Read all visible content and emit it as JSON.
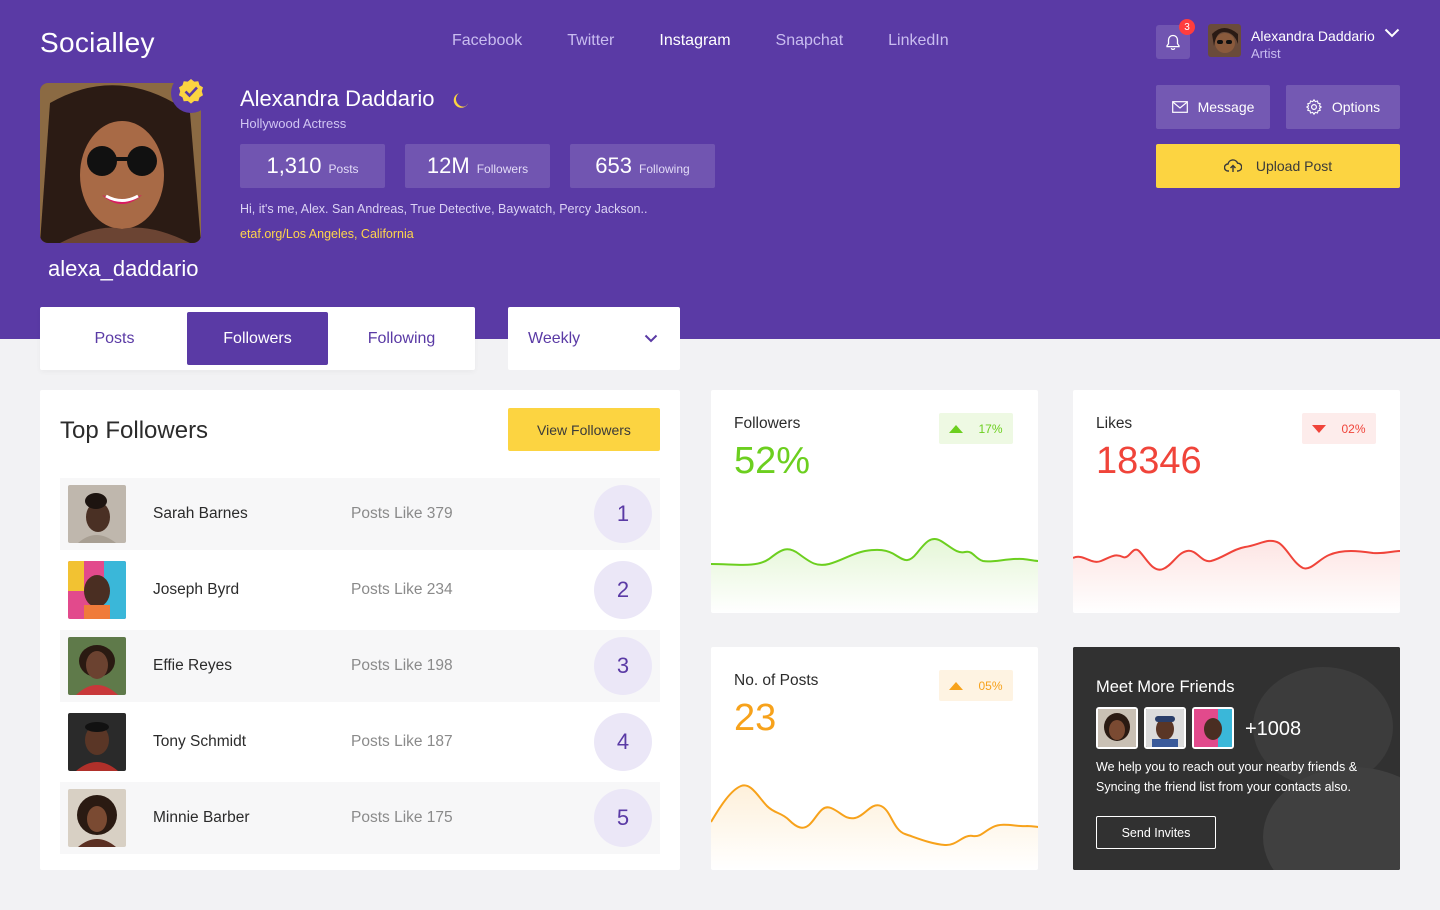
{
  "brand": "Socialley",
  "nav": {
    "items": [
      {
        "label": "Facebook",
        "active": false
      },
      {
        "label": "Twitter",
        "active": false
      },
      {
        "label": "Instagram",
        "active": true
      },
      {
        "label": "Snapchat",
        "active": false
      },
      {
        "label": "LinkedIn",
        "active": false
      }
    ]
  },
  "notifications": {
    "count": "3"
  },
  "current_user": {
    "name": "Alexandra Daddario",
    "role": "Artist"
  },
  "profile": {
    "name": "Alexandra Daddario",
    "title": "Hollywood Actress",
    "handle": "alexa_daddario",
    "stats": [
      {
        "value": "1,310",
        "label": "Posts"
      },
      {
        "value": "12M",
        "label": "Followers"
      },
      {
        "value": "653",
        "label": "Following"
      }
    ],
    "bio": "Hi, it's me, Alex. San Andreas, True Detective, Baywatch, Percy Jackson..",
    "link": "etaf.org/Los Angeles, California"
  },
  "actions": {
    "message": "Message",
    "options": "Options",
    "upload": "Upload Post"
  },
  "tabs": [
    {
      "label": "Posts",
      "active": false
    },
    {
      "label": "Followers",
      "active": true
    },
    {
      "label": "Following",
      "active": false
    }
  ],
  "period": {
    "selected": "Weekly"
  },
  "top_followers": {
    "title": "Top Followers",
    "view_button": "View Followers",
    "rows": [
      {
        "name": "Sarah Barnes",
        "likes": "Posts Like 379",
        "rank": "1"
      },
      {
        "name": "Joseph Byrd",
        "likes": "Posts Like 234",
        "rank": "2"
      },
      {
        "name": "Effie Reyes",
        "likes": "Posts Like 198",
        "rank": "3"
      },
      {
        "name": "Tony Schmidt",
        "likes": "Posts Like 187",
        "rank": "4"
      },
      {
        "name": "Minnie Barber",
        "likes": "Posts Like 175",
        "rank": "5"
      }
    ]
  },
  "metrics": {
    "followers": {
      "label": "Followers",
      "value": "52%",
      "change": "17%",
      "direction": "up",
      "color": "#6ccf1f",
      "badge_bg": "#eef9e3"
    },
    "likes": {
      "label": "Likes",
      "value": "18346",
      "change": "02%",
      "direction": "down",
      "color": "#f0443a",
      "badge_bg": "#fdeceb"
    },
    "posts": {
      "label": "No. of Posts",
      "value": "23",
      "change": "05%",
      "direction": "up",
      "color": "#f7a21b",
      "badge_bg": "#fef3e2"
    }
  },
  "meet_friends": {
    "title": "Meet More Friends",
    "extra_count": "+1008",
    "description": "We help you to reach out your nearby friends & Syncing the friend list from your contacts also.",
    "button": "Send Invites"
  },
  "colors": {
    "primary": "#5a3aa5",
    "accent": "#fcd441"
  }
}
